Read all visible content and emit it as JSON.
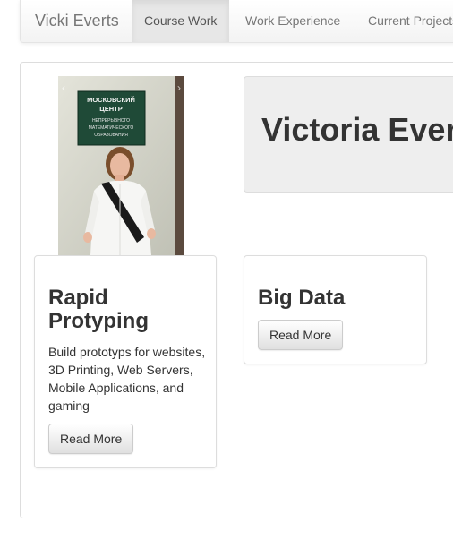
{
  "navbar": {
    "brand": "Vicki Everts",
    "items": [
      {
        "label": "Course Work",
        "active": true
      },
      {
        "label": "Work Experience",
        "active": false
      },
      {
        "label": "Current Projects",
        "active": false
      }
    ]
  },
  "photo": {
    "sign_text": [
      "МОСКОВСКИЙ",
      "ЦЕНТР",
      "НЕПРЕРЫВНОГО",
      "МАТЕМАТИЧЕСКОГО",
      "ОБРАЗОВАНИЯ"
    ],
    "prev_icon": "chevron-left-icon",
    "next_icon": "chevron-right-icon"
  },
  "jumbotron": {
    "title": "Victoria Everts"
  },
  "cards": [
    {
      "title": "Rapid Protyping",
      "text": "Build prototyps for websites, 3D Printing, Web Servers, Mobile Applications, and gaming",
      "button": "Read More"
    },
    {
      "title": "Big Data",
      "button": "Read More"
    }
  ],
  "colors": {
    "navbar_bg": "#f8f8f8",
    "nav_active_bg": "#e7e7e7",
    "jumbotron_bg": "#eeeeee",
    "text": "#333333",
    "nav_text": "#777777"
  }
}
